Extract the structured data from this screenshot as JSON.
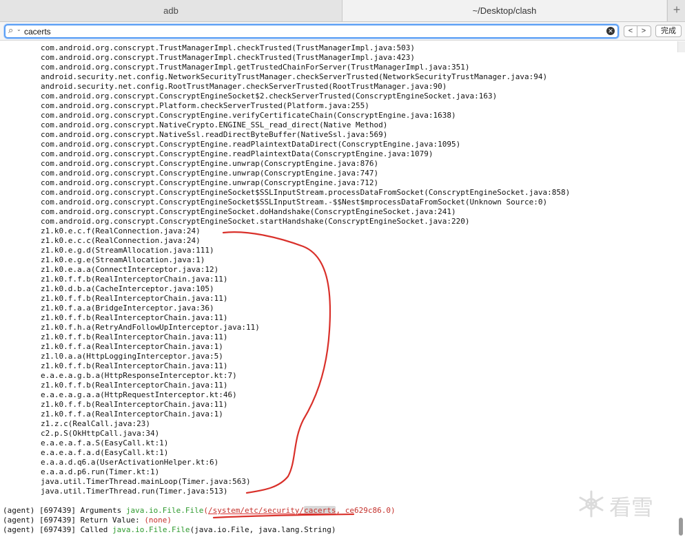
{
  "tabs": [
    {
      "label": "adb"
    },
    {
      "label": "~/Desktop/clash"
    }
  ],
  "new_tab": "+",
  "find": {
    "value": "cacerts",
    "prev": "<",
    "next": ">",
    "done": "完成",
    "icons": {
      "search": "magnifier-icon",
      "clear": "clear-icon"
    }
  },
  "trace": [
    "com.android.org.conscrypt.TrustManagerImpl.checkTrusted(TrustManagerImpl.java:503)",
    "com.android.org.conscrypt.TrustManagerImpl.checkTrusted(TrustManagerImpl.java:423)",
    "com.android.org.conscrypt.TrustManagerImpl.getTrustedChainForServer(TrustManagerImpl.java:351)",
    "android.security.net.config.NetworkSecurityTrustManager.checkServerTrusted(NetworkSecurityTrustManager.java:94)",
    "android.security.net.config.RootTrustManager.checkServerTrusted(RootTrustManager.java:90)",
    "com.android.org.conscrypt.ConscryptEngineSocket$2.checkServerTrusted(ConscryptEngineSocket.java:163)",
    "com.android.org.conscrypt.Platform.checkServerTrusted(Platform.java:255)",
    "com.android.org.conscrypt.ConscryptEngine.verifyCertificateChain(ConscryptEngine.java:1638)",
    "com.android.org.conscrypt.NativeCrypto.ENGINE_SSL_read_direct(Native Method)",
    "com.android.org.conscrypt.NativeSsl.readDirectByteBuffer(NativeSsl.java:569)",
    "com.android.org.conscrypt.ConscryptEngine.readPlaintextDataDirect(ConscryptEngine.java:1095)",
    "com.android.org.conscrypt.ConscryptEngine.readPlaintextData(ConscryptEngine.java:1079)",
    "com.android.org.conscrypt.ConscryptEngine.unwrap(ConscryptEngine.java:876)",
    "com.android.org.conscrypt.ConscryptEngine.unwrap(ConscryptEngine.java:747)",
    "com.android.org.conscrypt.ConscryptEngine.unwrap(ConscryptEngine.java:712)",
    "com.android.org.conscrypt.ConscryptEngineSocket$SSLInputStream.processDataFromSocket(ConscryptEngineSocket.java:858)",
    "com.android.org.conscrypt.ConscryptEngineSocket$SSLInputStream.-$$Nest$mprocessDataFromSocket(Unknown Source:0)",
    "com.android.org.conscrypt.ConscryptEngineSocket.doHandshake(ConscryptEngineSocket.java:241)",
    "com.android.org.conscrypt.ConscryptEngineSocket.startHandshake(ConscryptEngineSocket.java:220)",
    "z1.k0.e.c.f(RealConnection.java:24)",
    "z1.k0.e.c.c(RealConnection.java:24)",
    "z1.k0.e.g.d(StreamAllocation.java:111)",
    "z1.k0.e.g.e(StreamAllocation.java:1)",
    "z1.k0.e.a.a(ConnectInterceptor.java:12)",
    "z1.k0.f.f.b(RealInterceptorChain.java:11)",
    "z1.k0.d.b.a(CacheInterceptor.java:105)",
    "z1.k0.f.f.b(RealInterceptorChain.java:11)",
    "z1.k0.f.a.a(BridgeInterceptor.java:36)",
    "z1.k0.f.f.b(RealInterceptorChain.java:11)",
    "z1.k0.f.h.a(RetryAndFollowUpInterceptor.java:11)",
    "z1.k0.f.f.b(RealInterceptorChain.java:11)",
    "z1.k0.f.f.a(RealInterceptorChain.java:1)",
    "z1.l0.a.a(HttpLoggingInterceptor.java:5)",
    "z1.k0.f.f.b(RealInterceptorChain.java:11)",
    "e.a.e.a.g.b.a(HttpResponseInterceptor.kt:7)",
    "z1.k0.f.f.b(RealInterceptorChain.java:11)",
    "e.a.e.a.g.a.a(HttpRequestInterceptor.kt:46)",
    "z1.k0.f.f.b(RealInterceptorChain.java:11)",
    "z1.k0.f.f.a(RealInterceptorChain.java:1)",
    "z1.z.c(RealCall.java:23)",
    "c2.p.S(OkHttpCall.java:34)",
    "e.a.e.a.f.a.S(EasyCall.kt:1)",
    "e.a.e.a.f.a.d(EasyCall.kt:1)",
    "e.a.a.d.q6.a(UserActivationHelper.kt:6)",
    "e.a.a.d.p6.run(Timer.kt:1)",
    "java.util.TimerThread.mainLoop(Timer.java:563)",
    "java.util.TimerThread.run(Timer.java:513)"
  ],
  "agent_lines": [
    {
      "prefix": "(agent)",
      "pid": "[697439]",
      "label": "Arguments",
      "call": "java.io.File.File",
      "open": "(",
      "path_a": "/system/etc/security/",
      "path_b": "cacerts",
      "sep": ", ",
      "hash": "ce629c86.0",
      "close": ")"
    },
    {
      "prefix": "(agent)",
      "pid": "[697439]",
      "label": "Return Value:",
      "value": "(none)"
    },
    {
      "prefix": "(agent)",
      "pid": "[697439]",
      "label": "Called",
      "call": "java.io.File.File",
      "args": "(java.io.File, java.lang.String)"
    }
  ],
  "watermark": {
    "text": "看雪",
    "icon": "snowflake-logo-icon"
  },
  "colors": {
    "accent": "#5b9ff5",
    "log_green": "#2e9a2e",
    "log_red": "#c4302b",
    "annotation": "#d9302a"
  }
}
